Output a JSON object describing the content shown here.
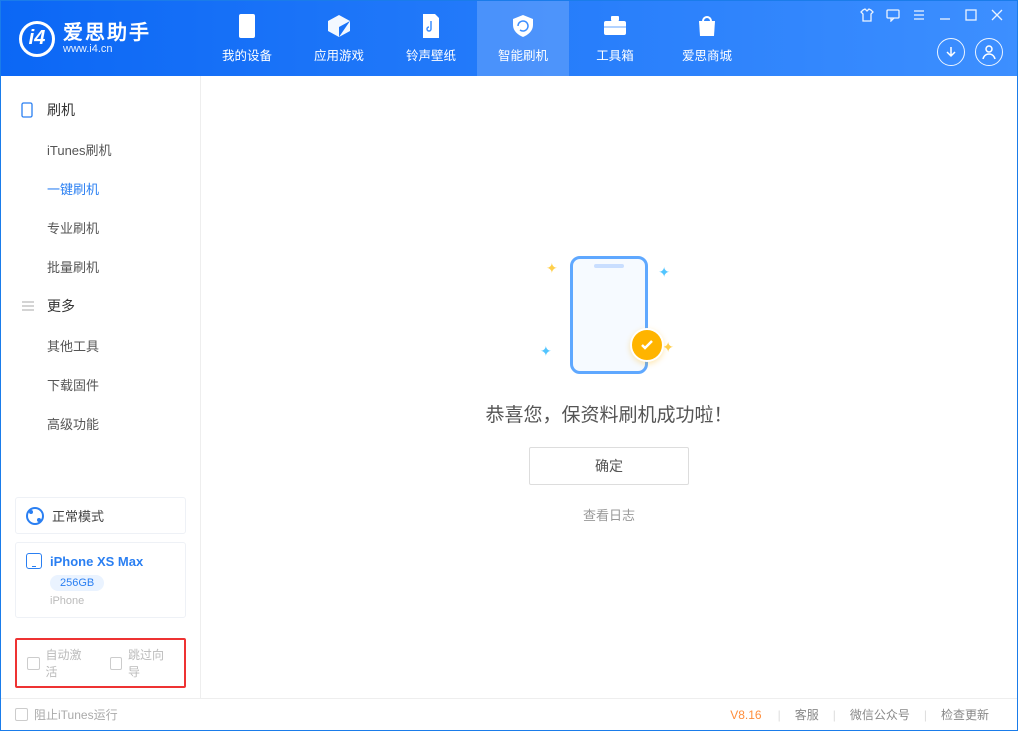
{
  "app": {
    "name_cn": "爱思助手",
    "name_en": "www.i4.cn"
  },
  "nav": {
    "items": [
      {
        "label": "我的设备"
      },
      {
        "label": "应用游戏"
      },
      {
        "label": "铃声壁纸"
      },
      {
        "label": "智能刷机"
      },
      {
        "label": "工具箱"
      },
      {
        "label": "爱思商城"
      }
    ],
    "active_index": 3
  },
  "sidebar": {
    "groups": [
      {
        "title": "刷机",
        "items": [
          "iTunes刷机",
          "一键刷机",
          "专业刷机",
          "批量刷机"
        ],
        "active_item": 1
      },
      {
        "title": "更多",
        "items": [
          "其他工具",
          "下载固件",
          "高级功能"
        ],
        "active_item": -1
      }
    ]
  },
  "device": {
    "mode": "正常模式",
    "name": "iPhone XS Max",
    "capacity": "256GB",
    "model": "iPhone"
  },
  "checks": {
    "auto_activate": "自动激活",
    "skip_wizard": "跳过向导"
  },
  "main": {
    "success": "恭喜您，保资料刷机成功啦！",
    "ok": "确定",
    "view_log": "查看日志"
  },
  "footer": {
    "stop_itunes": "阻止iTunes运行",
    "version": "V8.16",
    "links": [
      "客服",
      "微信公众号",
      "检查更新"
    ]
  }
}
